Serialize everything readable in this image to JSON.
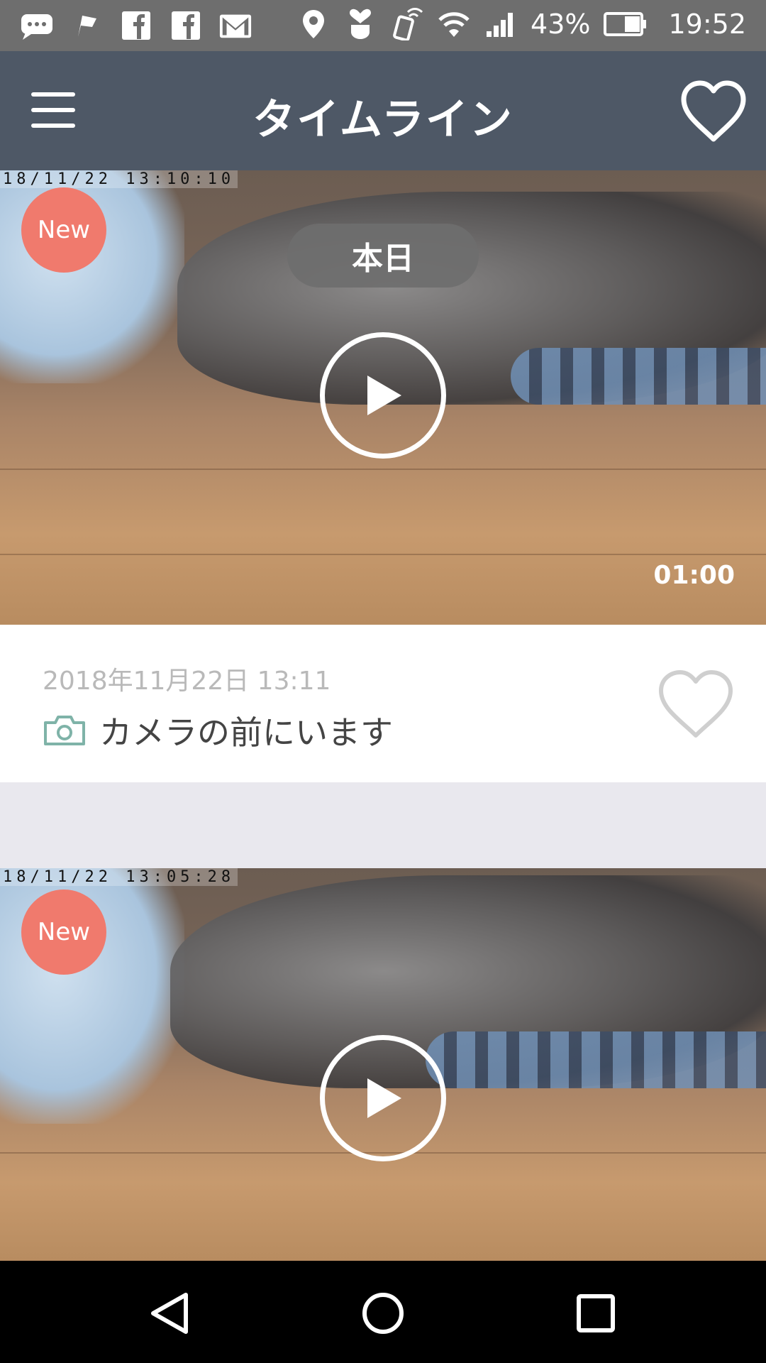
{
  "status_bar": {
    "battery": "43%",
    "time": "19:52",
    "left_icons": [
      "message-icon",
      "flag-icon",
      "facebook-icon",
      "facebook-icon",
      "gmail-icon"
    ],
    "right_icons": [
      "location-icon",
      "heart-hand-icon",
      "nfc-icon",
      "wifi-icon",
      "signal-icon",
      "battery-icon"
    ]
  },
  "app_bar": {
    "title": "タイムライン",
    "menu_icon": "hamburger-menu-icon",
    "favorite_icon": "heart-outline-icon"
  },
  "timeline": [
    {
      "osd_timestamp": "18/11/22  13:10:10",
      "badge": "New",
      "date_pill": "本日",
      "duration": "01:00",
      "date": "2018年11月22日 13:11",
      "description": "カメラの前にいます"
    },
    {
      "osd_timestamp": "18/11/22  13:05:28",
      "badge": "New"
    }
  ],
  "colors": {
    "status_bar": "#6e6e6e",
    "app_bar": "#4e5866",
    "badge": "#f07a6d",
    "camera_icon": "#7fb3a8",
    "separator": "#e9e8ee"
  },
  "nav_bar": {
    "icons": [
      "back-icon",
      "home-icon",
      "recents-icon"
    ]
  }
}
